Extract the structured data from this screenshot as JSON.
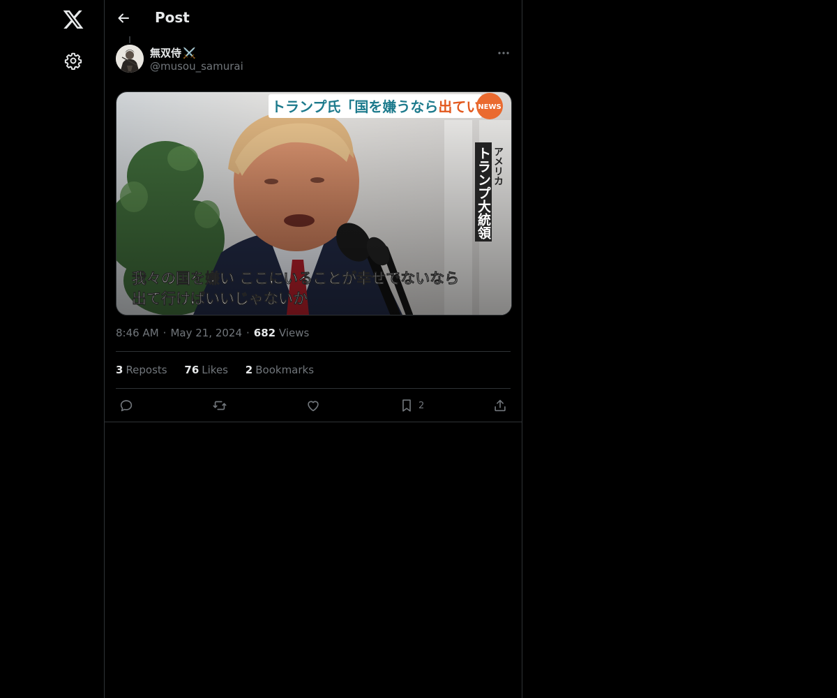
{
  "header": {
    "title": "Post"
  },
  "author": {
    "display_name": "無双侍",
    "emoji": "⚔️",
    "handle": "@musou_samurai"
  },
  "media": {
    "headline_left": "トランプ氏「国を嫌うなら",
    "headline_highlight": "出ていけ",
    "headline_close": "」",
    "badge": "NEWS",
    "side_caption_small": "アメリカ",
    "side_caption_large": "トランプ大統領",
    "subtitle_line1": "我々の国を嫌い ここにいることが幸せでないなら",
    "subtitle_line2": "出て行けばいいじゃないか"
  },
  "meta": {
    "time": "8:46 AM",
    "separator": "·",
    "date": "May 21, 2024",
    "views_count": "682",
    "views_label": "Views"
  },
  "stats": {
    "reposts_count": "3",
    "reposts_label": "Reposts",
    "likes_count": "76",
    "likes_label": "Likes",
    "bookmarks_count": "2",
    "bookmarks_label": "Bookmarks"
  },
  "actions": {
    "bookmark_count": "2"
  },
  "icons": [
    "x-logo-icon",
    "gear-icon",
    "back-arrow-icon",
    "more-icon",
    "reply-icon",
    "repost-icon",
    "like-icon",
    "bookmark-icon",
    "share-icon"
  ],
  "colors": {
    "background": "#000000",
    "text": "#e7e9ea",
    "muted": "#71767b",
    "border": "#2f3336"
  }
}
